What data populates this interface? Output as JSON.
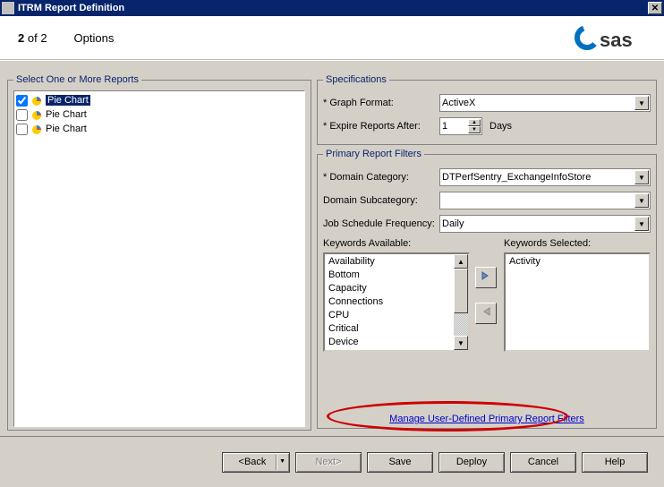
{
  "window": {
    "title": "ITRM Report Definition"
  },
  "step": {
    "current": "2",
    "total": "of 2",
    "options": "Options"
  },
  "logo_text": "sas",
  "reports": {
    "legend": "Select One or More Reports",
    "items": [
      {
        "label": "Pie Chart",
        "checked": true,
        "selected": true
      },
      {
        "label": "Pie Chart",
        "checked": false,
        "selected": false
      },
      {
        "label": "Pie Chart",
        "checked": false,
        "selected": false
      }
    ]
  },
  "spec": {
    "legend": "Specifications",
    "graph_format_label": "* Graph Format:",
    "graph_format_value": "ActiveX",
    "expire_label": "* Expire Reports After:",
    "expire_value": "1",
    "expire_unit": "Days"
  },
  "filters": {
    "legend": "Primary Report Filters",
    "domain_cat_label": "* Domain Category:",
    "domain_cat_value": "DTPerfSentry_ExchangeInfoStore",
    "domain_sub_label": "Domain Subcategory:",
    "domain_sub_value": "",
    "job_freq_label": "Job Schedule Frequency:",
    "job_freq_value": "Daily",
    "keywords_available_label": "Keywords Available:",
    "keywords_selected_label": "Keywords Selected:",
    "keywords_available": [
      "Availability",
      "Bottom",
      "Capacity",
      "Connections",
      "CPU",
      "Critical",
      "Device"
    ],
    "keywords_selected": [
      "Activity"
    ],
    "manage_link": "Manage User-Defined Primary Report Filters"
  },
  "buttons": {
    "back": "<Back",
    "next": "Next>",
    "save": "Save",
    "deploy": "Deploy",
    "cancel": "Cancel",
    "help": "Help"
  }
}
